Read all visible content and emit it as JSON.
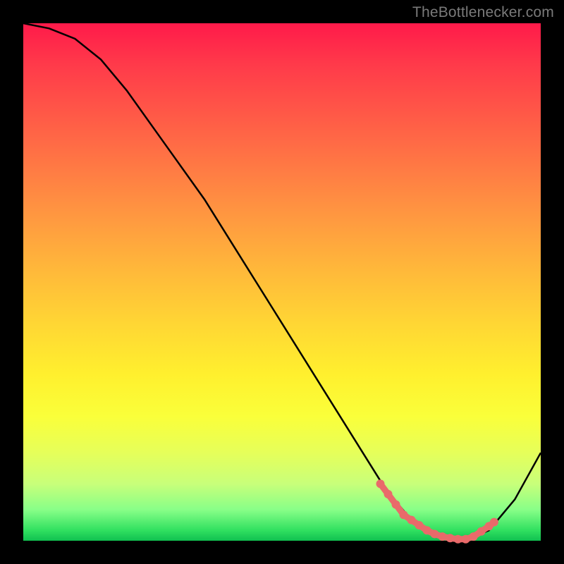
{
  "source_label": "TheBottlenecker.com",
  "chart_data": {
    "type": "line",
    "title": "",
    "xlabel": "",
    "ylabel": "",
    "xlim": [
      0,
      100
    ],
    "ylim": [
      0,
      100
    ],
    "series": [
      {
        "name": "curve",
        "x": [
          0,
          5,
          10,
          15,
          20,
          25,
          30,
          35,
          40,
          45,
          50,
          55,
          60,
          65,
          70,
          75,
          80,
          85,
          90,
          95,
          100
        ],
        "values": [
          100,
          99,
          97,
          93,
          87,
          80,
          73,
          66,
          58,
          50,
          42,
          34,
          26,
          18,
          10,
          4,
          1,
          0,
          2,
          8,
          17
        ]
      }
    ],
    "highlight_range_x": [
      70,
      90
    ],
    "highlight_points": [
      {
        "x": 69,
        "y": 11
      },
      {
        "x": 70.5,
        "y": 9
      },
      {
        "x": 72,
        "y": 7
      },
      {
        "x": 73.5,
        "y": 5
      },
      {
        "x": 75,
        "y": 4
      },
      {
        "x": 76.5,
        "y": 3
      },
      {
        "x": 78,
        "y": 2
      },
      {
        "x": 79.5,
        "y": 1.3
      },
      {
        "x": 81,
        "y": 0.8
      },
      {
        "x": 82.5,
        "y": 0.5
      },
      {
        "x": 84,
        "y": 0.3
      },
      {
        "x": 85.5,
        "y": 0.3
      },
      {
        "x": 87,
        "y": 0.8
      },
      {
        "x": 88.5,
        "y": 1.8
      },
      {
        "x": 90,
        "y": 2.8
      },
      {
        "x": 91,
        "y": 3.6
      }
    ],
    "colors": {
      "curve": "#000000",
      "highlight": "#e96a6a"
    }
  }
}
